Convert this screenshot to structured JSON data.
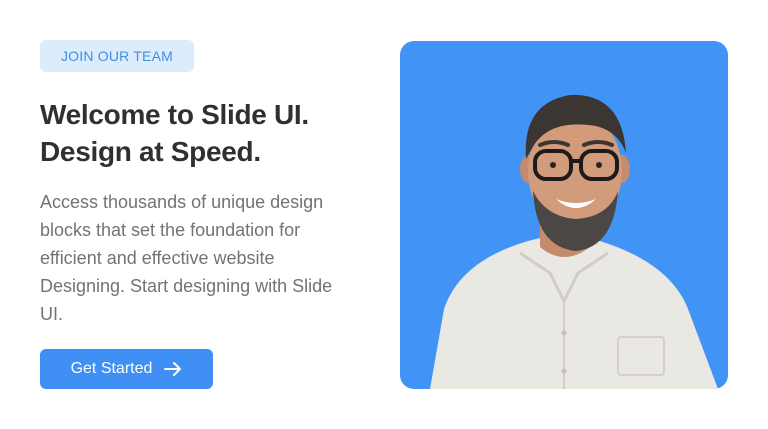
{
  "badge": {
    "label": "JOIN OUR TEAM"
  },
  "headline": {
    "line1": "Welcome to Slide UI.",
    "line2": "Design at Speed."
  },
  "description": "Access thousands of unique design blocks that set the foundation for efficient and effective website Designing. Start designing with Slide UI.",
  "cta": {
    "label": "Get Started",
    "icon": "arrow-right-icon"
  },
  "colors": {
    "accent": "#3f8ff4",
    "badge_bg": "#dcecfd",
    "badge_text": "#3d8fe6",
    "photo_bg": "#4193f6",
    "heading": "#2f3033",
    "body_text": "#707378"
  }
}
